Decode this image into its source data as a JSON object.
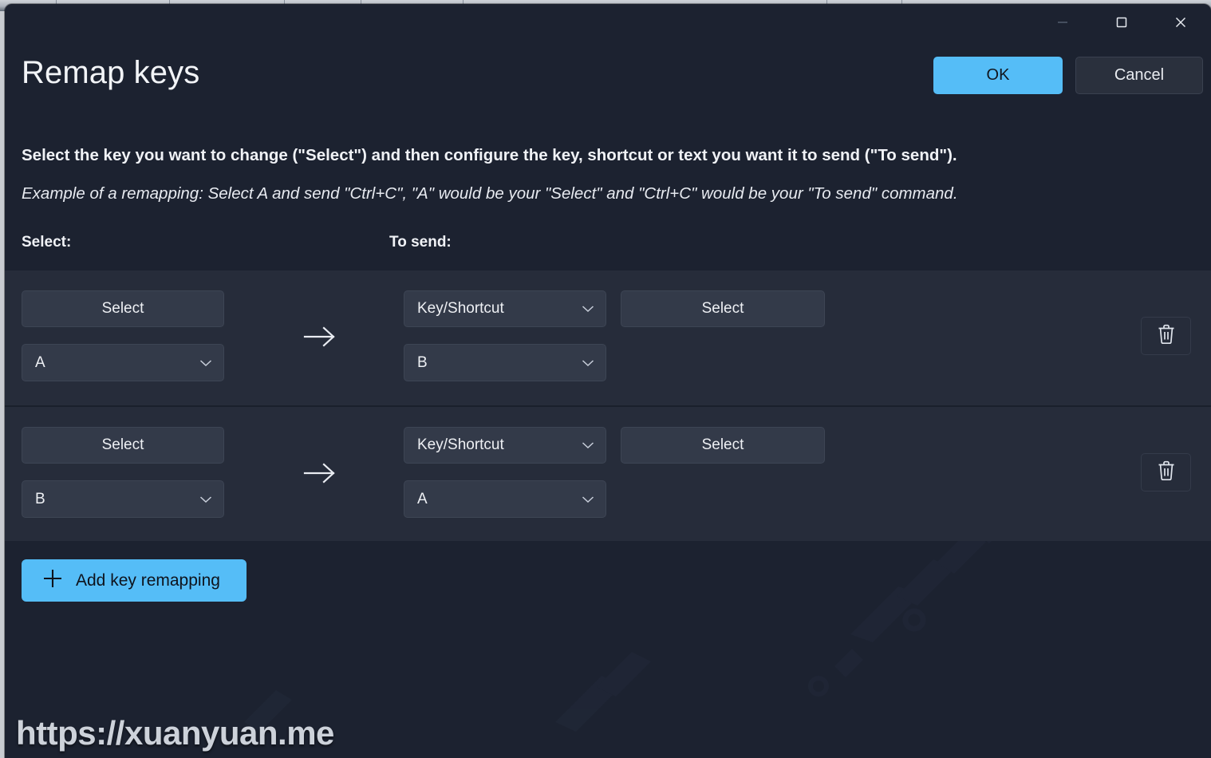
{
  "window": {
    "controls": {
      "minimize_label": "Minimize",
      "maximize_label": "Maximize",
      "close_label": "Close"
    }
  },
  "header": {
    "title": "Remap keys",
    "ok_label": "OK",
    "cancel_label": "Cancel"
  },
  "instructions": {
    "line1": "Select the key you want to change (\"Select\") and then configure the key, shortcut or text you want it to send (\"To send\").",
    "line2": "Example of a remapping: Select A and send \"Ctrl+C\", \"A\" would be your \"Select\" and \"Ctrl+C\" would be your \"To send\" command."
  },
  "columns": {
    "select_header": "Select:",
    "to_send_header": "To send:"
  },
  "rows": [
    {
      "select_button_label": "Select",
      "select_key": "A",
      "type_dropdown": "Key/Shortcut",
      "send_button_label": "Select",
      "send_key": "B",
      "delete_label": "Delete remapping"
    },
    {
      "select_button_label": "Select",
      "select_key": "B",
      "type_dropdown": "Key/Shortcut",
      "send_button_label": "Select",
      "send_key": "A",
      "delete_label": "Delete remapping"
    }
  ],
  "footer": {
    "add_label": "Add key remapping"
  },
  "watermark": {
    "url": "https://xuanyuan.me"
  },
  "colors": {
    "accent": "#55bdf7",
    "window_bg": "#1c2230",
    "panel_bg": "#262c3a",
    "control_bg": "#333a49",
    "text": "#f0f2f6"
  }
}
